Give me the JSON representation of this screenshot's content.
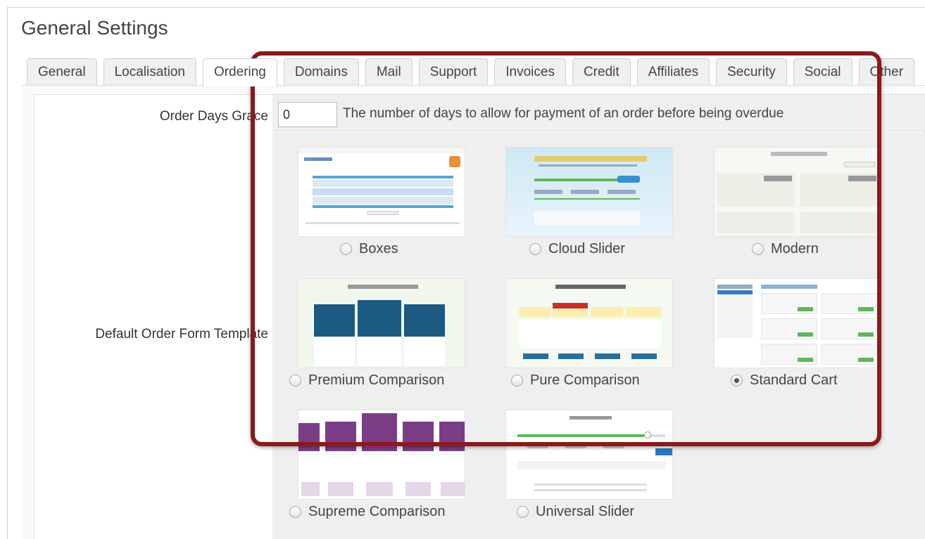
{
  "page": {
    "title": "General Settings"
  },
  "tabs": [
    {
      "label": "General"
    },
    {
      "label": "Localisation"
    },
    {
      "label": "Ordering",
      "active": true
    },
    {
      "label": "Domains"
    },
    {
      "label": "Mail"
    },
    {
      "label": "Support"
    },
    {
      "label": "Invoices"
    },
    {
      "label": "Credit"
    },
    {
      "label": "Affiliates"
    },
    {
      "label": "Security"
    },
    {
      "label": "Social"
    },
    {
      "label": "Other"
    }
  ],
  "order_days_grace": {
    "label": "Order Days Grace",
    "value": "0",
    "help": "The number of days to allow for payment of an order before being overdue"
  },
  "default_order_form": {
    "label": "Default Order Form Template",
    "selected": "Standard Cart",
    "templates": [
      {
        "name": "Boxes"
      },
      {
        "name": "Cloud Slider"
      },
      {
        "name": "Modern"
      },
      {
        "name": "Premium Comparison"
      },
      {
        "name": "Pure Comparison"
      },
      {
        "name": "Standard Cart"
      },
      {
        "name": "Supreme Comparison"
      },
      {
        "name": "Universal Slider"
      }
    ]
  },
  "colors": {
    "highlight": "#8b1a1a",
    "tab_bg": "#f0f0f0",
    "field_bg": "#efefef"
  }
}
